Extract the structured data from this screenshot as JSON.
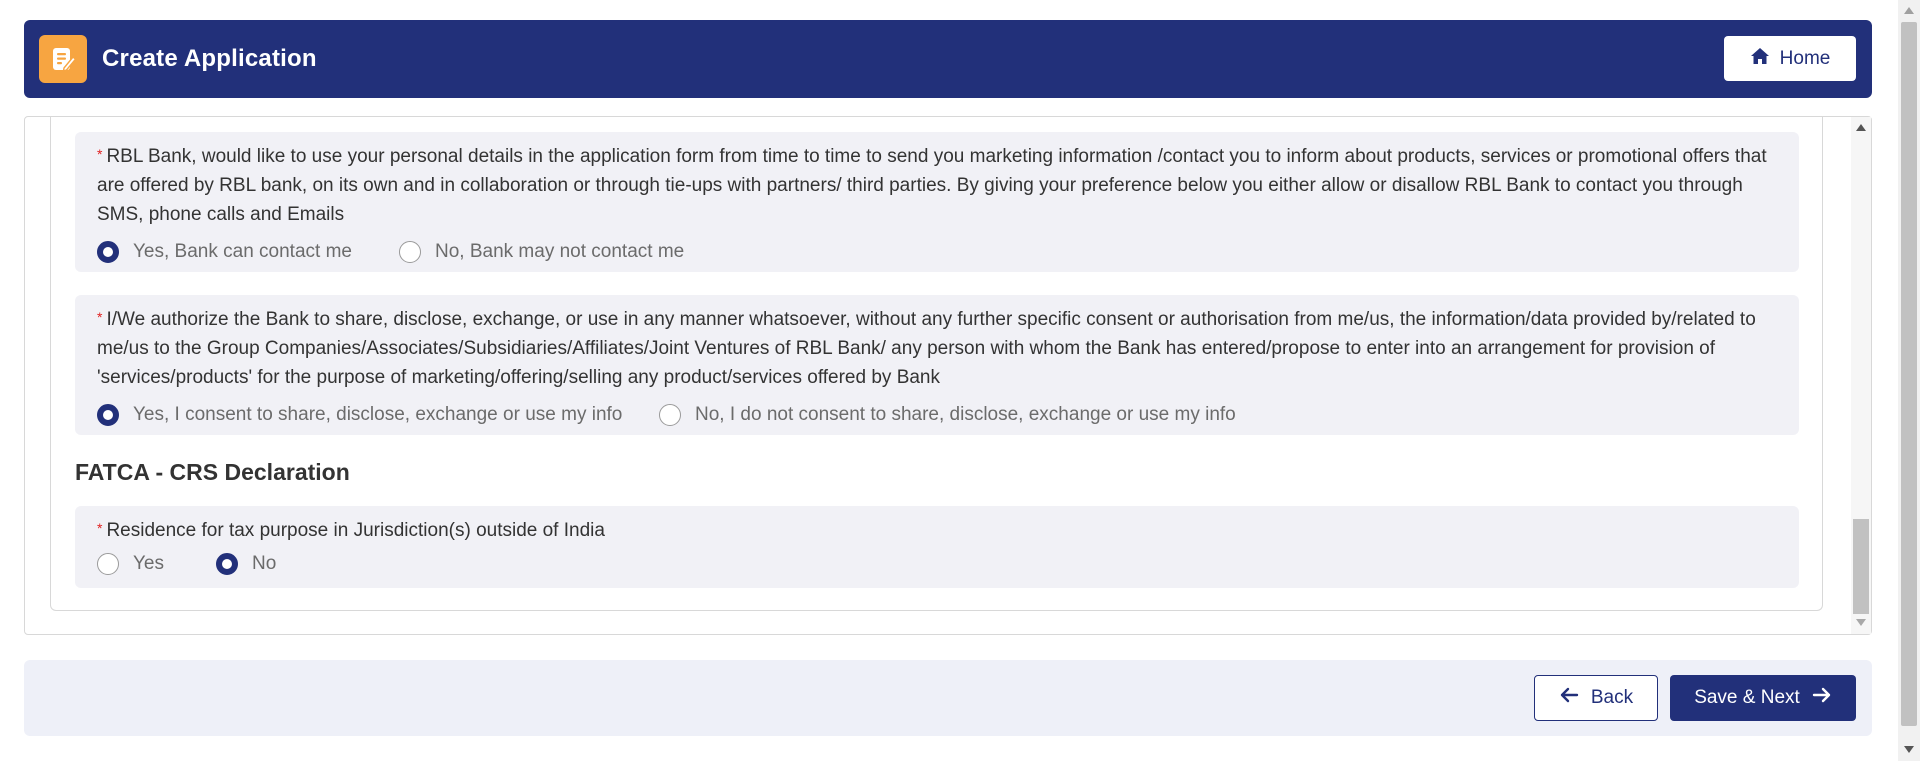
{
  "header": {
    "title": "Create Application",
    "home_label": "Home",
    "app_icon": "edit-document-icon",
    "home_icon": "home-icon"
  },
  "consent_marketing": {
    "question": "RBL Bank, would like to use your personal details in the application form from time to time to send you marketing information /contact you to inform about products, services or promotional offers that are offered by RBL bank, on its own and in collaboration or through tie-ups with partners/ third parties. By giving your preference below you either allow or disallow RBL Bank to contact you through SMS, phone calls and Emails",
    "required_mark": "*",
    "options": [
      {
        "label": "Yes, Bank can contact me",
        "checked": true
      },
      {
        "label": "No, Bank may not contact me",
        "checked": false
      }
    ]
  },
  "consent_share": {
    "question": "I/We authorize the Bank to share, disclose, exchange, or use in any manner whatsoever, without any further specific consent or authorisation from me/us, the information/data provided by/related to me/us to the Group Companies/Associates/Subsidiaries/Affiliates/Joint Ventures of RBL Bank/ any person with whom the Bank has entered/propose to enter into an arrangement for provision of 'services/products' for the purpose of marketing/offering/selling any product/services offered by Bank",
    "required_mark": "*",
    "options": [
      {
        "label": "Yes, I consent to share, disclose, exchange or use my info",
        "checked": true
      },
      {
        "label": "No, I do not consent to share, disclose, exchange or use my info",
        "checked": false
      }
    ]
  },
  "fatca": {
    "section_title": "FATCA - CRS Declaration",
    "question": "Residence for tax purpose in Jurisdiction(s) outside of India",
    "required_mark": "*",
    "options": [
      {
        "label": "Yes",
        "checked": false
      },
      {
        "label": "No",
        "checked": true
      }
    ]
  },
  "footer": {
    "back_label": "Back",
    "next_label": "Save & Next",
    "back_icon": "arrow-left-icon",
    "next_icon": "arrow-right-icon"
  },
  "colors": {
    "primary": "#22307a",
    "accent": "#f7a541",
    "required": "#e02020"
  }
}
